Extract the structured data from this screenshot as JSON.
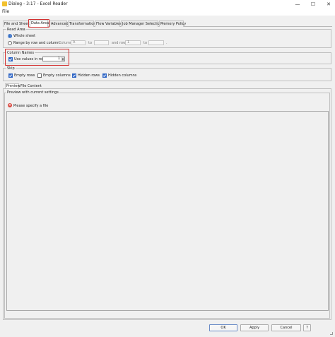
{
  "window": {
    "title": "Dialog - 3:17 - Excel Reader",
    "minimize_glyph": "—",
    "maximize_glyph": "☐",
    "close_glyph": "✕"
  },
  "menu": {
    "file": "File"
  },
  "tabs": [
    {
      "label": "File and Sheet",
      "active": false
    },
    {
      "label": "Data Area",
      "active": true
    },
    {
      "label": "Advanced",
      "active": false
    },
    {
      "label": "Transformation",
      "active": false
    },
    {
      "label": "Flow Variables",
      "active": false
    },
    {
      "label": "Job Manager Selection",
      "active": false
    },
    {
      "label": "Memory Policy",
      "active": false
    }
  ],
  "read_area": {
    "title": "Read Area",
    "whole_sheet": "Whole sheet",
    "range_label": "Range by row and column:",
    "column_label": "Column",
    "column_from": "A",
    "to1": "to",
    "and_row": "and row",
    "row_from": "1",
    "to2": "to",
    "trailing": "."
  },
  "column_names": {
    "title": "Column Names",
    "use_values": "Use values in row",
    "row_value": "1",
    "spin_up": "▲",
    "spin_down": "▼"
  },
  "skip": {
    "title": "Skip",
    "empty_rows": "Empty rows",
    "empty_columns": "Empty columns",
    "hidden_rows": "Hidden rows",
    "hidden_columns": "Hidden columns"
  },
  "preview_tabs": {
    "preview": "Preview",
    "file_content": "File Content"
  },
  "preview": {
    "title": "Preview with current settings",
    "error_icon": "×",
    "error": "Please specify a file"
  },
  "buttons": {
    "ok": "OK",
    "apply": "Apply",
    "cancel": "Cancel",
    "help": "?"
  },
  "colors": {
    "highlight": "#d32f2f",
    "accent": "#2f66c6"
  }
}
